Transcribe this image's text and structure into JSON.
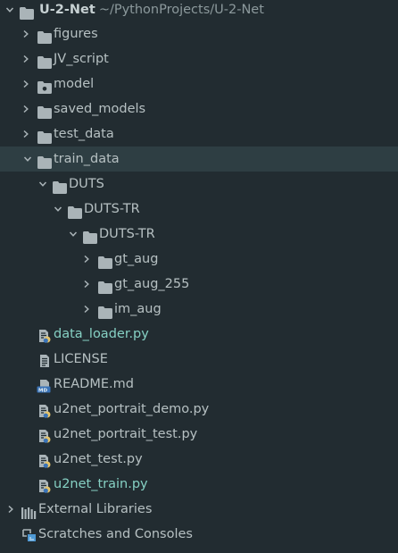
{
  "project": {
    "name": "U-2-Net",
    "path": "~/PythonProjects/U-2-Net"
  },
  "items": [
    {
      "label": "figures"
    },
    {
      "label": "JV_script"
    },
    {
      "label": "model"
    },
    {
      "label": "saved_models"
    },
    {
      "label": "test_data"
    },
    {
      "label": "train_data"
    },
    {
      "label": "DUTS"
    },
    {
      "label": "DUTS-TR"
    },
    {
      "label": "DUTS-TR"
    },
    {
      "label": "gt_aug"
    },
    {
      "label": "gt_aug_255"
    },
    {
      "label": "im_aug"
    },
    {
      "label": "data_loader.py"
    },
    {
      "label": "LICENSE"
    },
    {
      "label": "README.md"
    },
    {
      "label": "u2net_portrait_demo.py"
    },
    {
      "label": "u2net_portrait_test.py"
    },
    {
      "label": "u2net_test.py"
    },
    {
      "label": "u2net_train.py"
    }
  ],
  "external_libraries": "External Libraries",
  "scratches": "Scratches and Consoles",
  "colors": {
    "background": "#222c31",
    "selected_row": "#2e3e43",
    "folder_icon": "#aab4b8",
    "modified_file": "#86d1c4",
    "python_yellow": "#e5c46b"
  }
}
